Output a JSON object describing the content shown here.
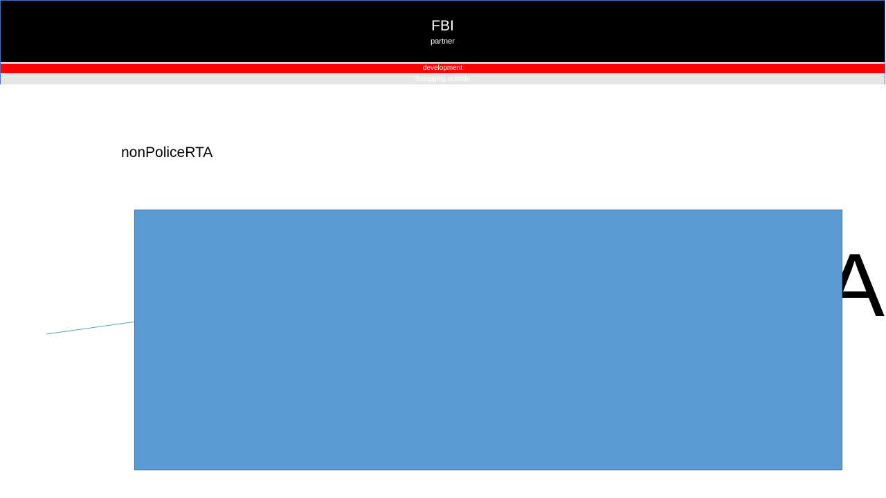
{
  "header": {
    "title": "FBI",
    "subtitle": "partner",
    "red_bar_label": "development",
    "gray_bar_label": "Sstepping outside"
  },
  "slide": {
    "heading": "nonPoliceRTA",
    "background_text": "RTA"
  },
  "colors": {
    "header_background": "#000000",
    "red_bar": "#ff0000",
    "gray_bar": "#e6e6e6",
    "shape_fill": "#5b9bd5",
    "shape_border": "#41719c",
    "connector": "#5b9bd5"
  }
}
